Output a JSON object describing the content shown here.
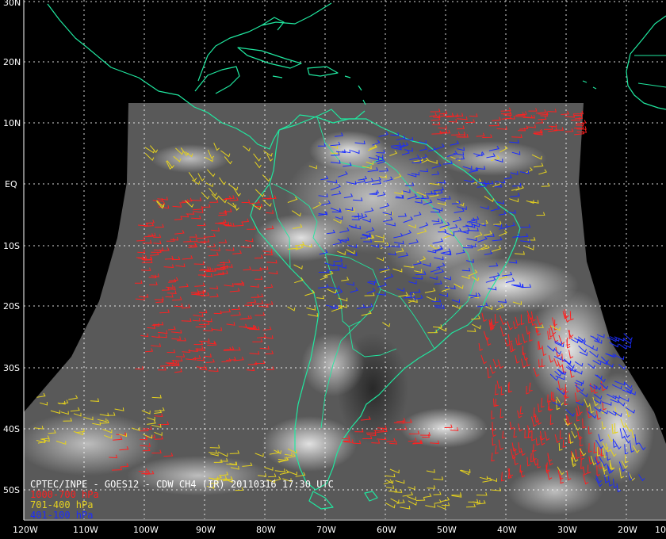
{
  "caption": "CPTEC/INPE - GOES12 - CDW CH4 (IR) 20110316 17:30 UTC",
  "legend": [
    {
      "label": "1000-700 hPa",
      "color": "#ff2020"
    },
    {
      "label": "701-400 hPa",
      "color": "#e6d21e"
    },
    {
      "label": "401-100 hPa",
      "color": "#1a2cff"
    }
  ],
  "latitude_labels": [
    "30N",
    "20N",
    "10N",
    "EQ",
    "10S",
    "20S",
    "30S",
    "40S",
    "50S"
  ],
  "longitude_labels": [
    "120W",
    "110W",
    "100W",
    "90W",
    "80W",
    "70W",
    "60W",
    "50W",
    "40W",
    "30W",
    "20W",
    "10"
  ],
  "colors": {
    "background": "#000000",
    "coastline": "#20e8a0",
    "graticule": "#ffffff",
    "ir_image": "#5a5a5a"
  }
}
